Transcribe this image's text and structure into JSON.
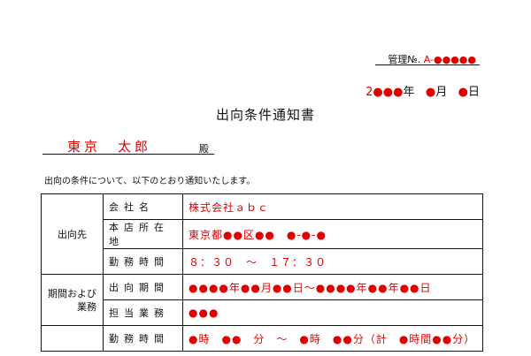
{
  "header": {
    "mgmt_label": "管理№.",
    "mgmt_value": "A-●●●●●",
    "date_year": "2●●●",
    "date_year_unit": "年",
    "date_month": "●",
    "date_month_unit": "月",
    "date_day": "●",
    "date_day_unit": "日"
  },
  "title": "出向条件通知書",
  "recipient": {
    "name": "東京　太郎",
    "honorific": "殿"
  },
  "intro": "出向の条件について、以下のとおり通知いたします。",
  "table": {
    "group1": "出向先",
    "group2_line1": "期間および",
    "group2_line2": "業務",
    "rows": [
      {
        "label": "会社名",
        "value": "株式会社ａｂｃ"
      },
      {
        "label": "本店所在地",
        "value": "東京都●●区●●　●-●-●"
      },
      {
        "label": "勤務時間",
        "value": "８：３０　～　１７：３０"
      },
      {
        "label": "出向期間",
        "value": "●●●●年●●月●●日～●●●●年●●年●●日"
      },
      {
        "label": "担当業務",
        "value": "●●●"
      },
      {
        "label": "勤務時間",
        "value": "●時　●●　分　～　●時　●●分（計　●時間●●分）"
      }
    ]
  }
}
